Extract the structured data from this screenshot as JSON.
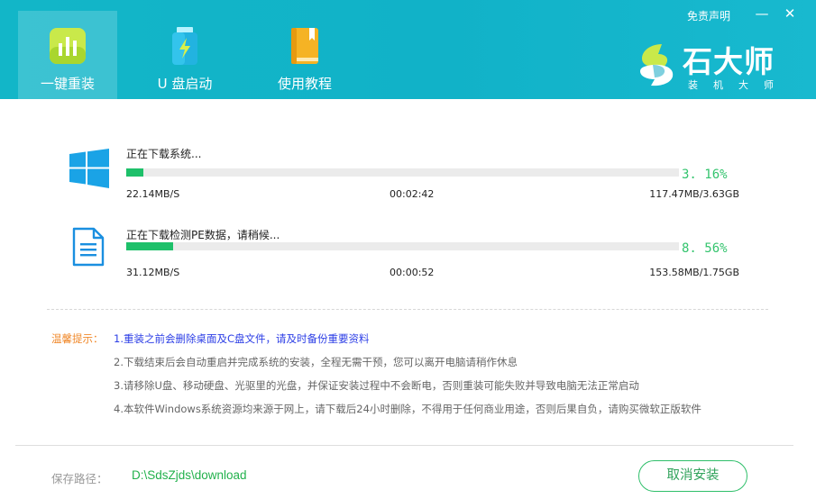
{
  "header": {
    "tabs": [
      {
        "label": "一键重装",
        "icon": "bar-chart-icon",
        "active": true
      },
      {
        "label": "U 盘启动",
        "icon": "usb-drive-icon",
        "active": false
      },
      {
        "label": "使用教程",
        "icon": "book-icon",
        "active": false
      }
    ],
    "disclaimer": "免责声明",
    "minimize_glyph": "—",
    "close_glyph": "✕",
    "brand": {
      "name": "石大师",
      "subtitle": "装机大师"
    }
  },
  "downloads": [
    {
      "icon": "windows-icon",
      "title": "正在下载系统...",
      "percent_text": "3. 16%",
      "progress": 0.0316,
      "speed": "22.14MB/S",
      "time": "00:02:42",
      "size": "117.47MB/3.63GB"
    },
    {
      "icon": "document-icon",
      "title": "正在下载检测PE数据，请稍候...",
      "percent_text": "8. 56%",
      "progress": 0.0856,
      "speed": "31.12MB/S",
      "time": "00:00:52",
      "size": "153.58MB/1.75GB"
    }
  ],
  "tips": {
    "title": "温馨提示：",
    "lines": [
      "1.重装之前会删除桌面及C盘文件，请及时备份重要资料",
      "2.下载结束后会自动重启并完成系统的安装，全程无需干预，您可以离开电脑请稍作休息",
      "3.请移除U盘、移动硬盘、光驱里的光盘，并保证安装过程中不会断电，否则重装可能失败并导致电脑无法正常启动",
      "4.本软件Windows系统资源均来源于网上，请下载后24小时删除，不得用于任何商业用途，否则后果自负，请购买微软正版软件"
    ]
  },
  "footer": {
    "path_label": "保存路径：",
    "path_value": "D:\\SdsZjds\\download",
    "cancel_label": "取消安装"
  },
  "colors": {
    "header_bg": "#12b6c8",
    "progress_fill": "#1ec06a",
    "percent_text": "#34c46e",
    "tip_title": "#f0882a",
    "tip_highlight": "#2c3ee6"
  }
}
